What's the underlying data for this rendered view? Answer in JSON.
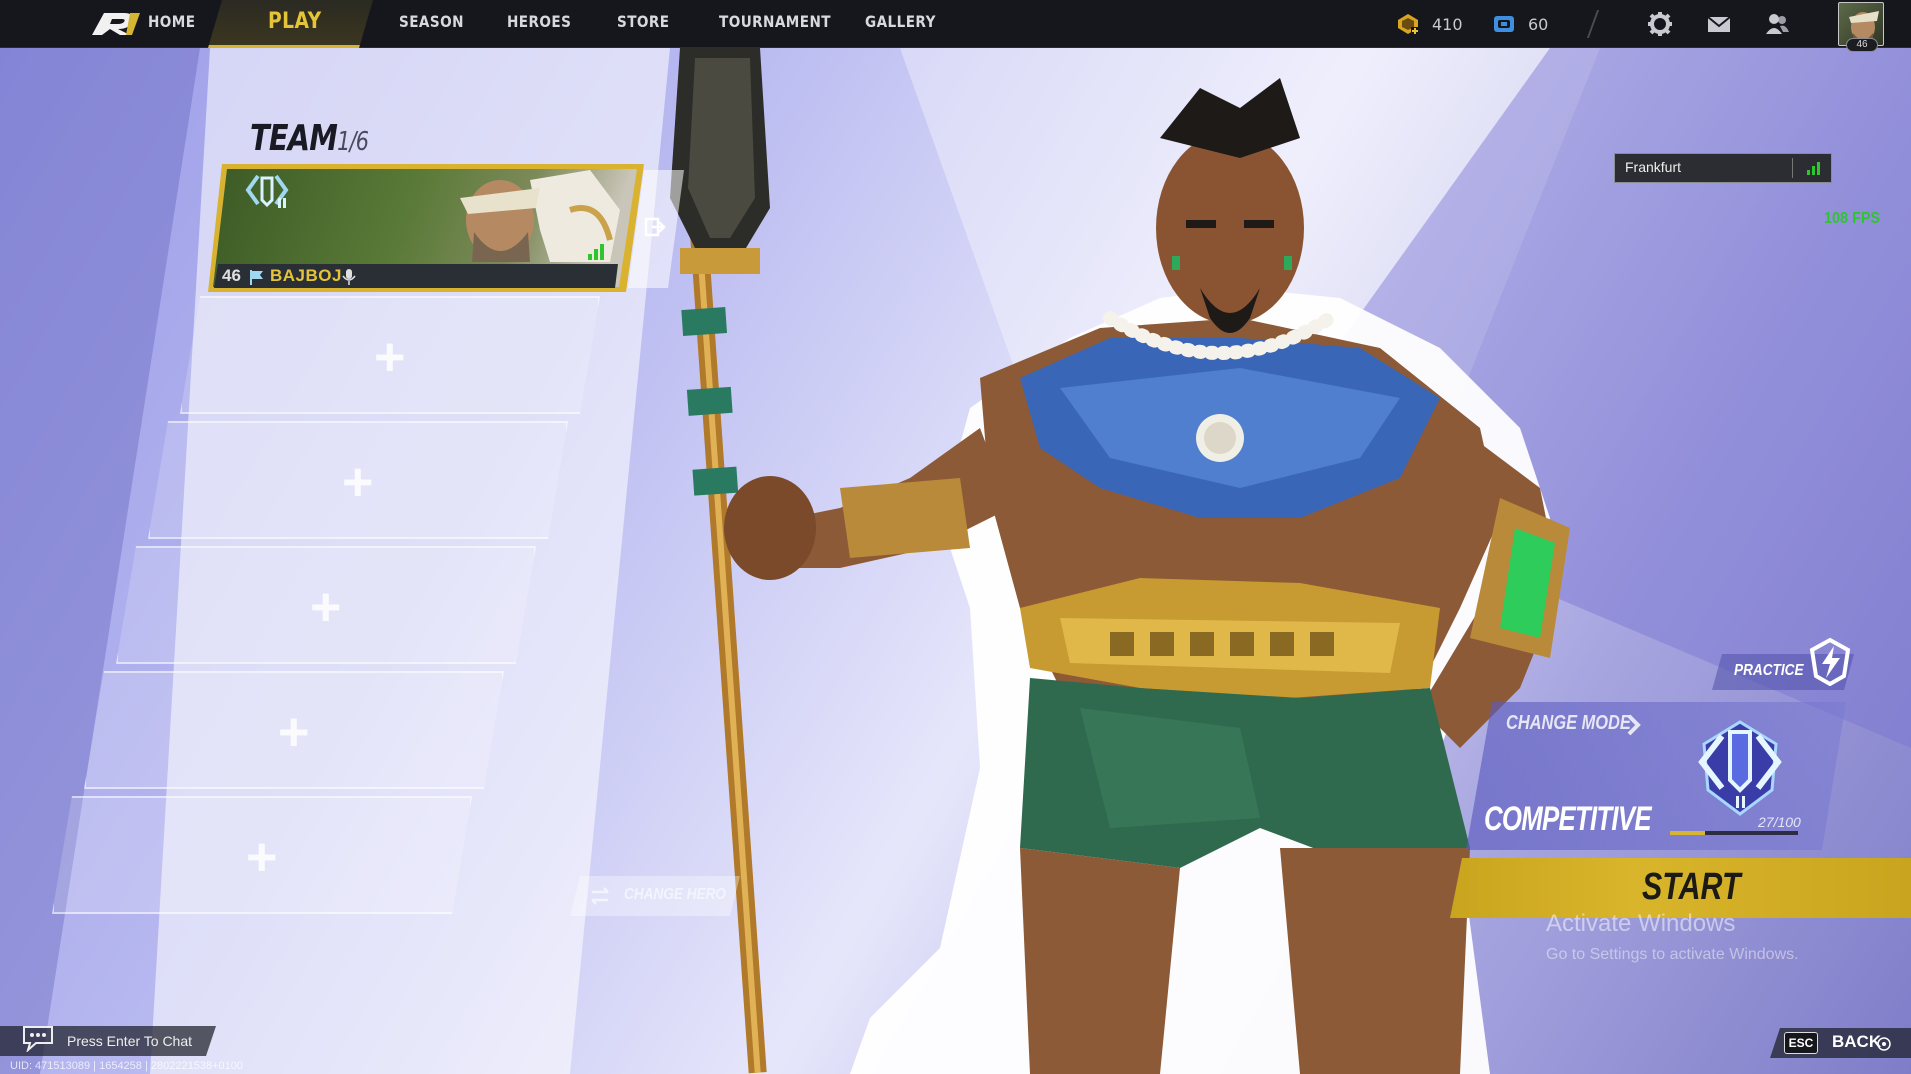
{
  "nav": {
    "home_label": "HOME",
    "items": [
      {
        "label": "PLAY",
        "active": true
      },
      {
        "label": "SEASON",
        "active": false
      },
      {
        "label": "HEROES",
        "active": false
      },
      {
        "label": "STORE",
        "active": false
      },
      {
        "label": "TOURNAMENT",
        "active": false
      },
      {
        "label": "GALLERY",
        "active": false
      }
    ],
    "currencies": [
      {
        "icon": "unit-coin-icon",
        "value": "410"
      },
      {
        "icon": "lattice-coin-icon",
        "value": "60"
      }
    ],
    "icons": [
      "settings-gear-icon",
      "mail-icon",
      "friends-icon"
    ],
    "avatar_level": "46"
  },
  "team": {
    "title": "TEAM",
    "count": "1/6",
    "player": {
      "level": "46",
      "name": "BAJBOJ",
      "rank_icon": "competitive-rank-icon"
    },
    "empty_slots": [
      "+",
      "+",
      "+",
      "+",
      "+"
    ],
    "change_hero_label": "CHANGE HERO"
  },
  "server": {
    "name": "Frankfurt",
    "fps": "108 FPS"
  },
  "mode": {
    "practice_label": "PRACTICE",
    "change_mode_label": "CHANGE MODE",
    "current_mode": "COMPETITIVE",
    "rank_progress": "27/100",
    "rank_progress_fraction": 0.27,
    "start_label": "START"
  },
  "watermark": {
    "title": "Activate Windows",
    "subtitle": "Go to Settings to activate Windows."
  },
  "bottom": {
    "chat_label": "Press Enter To Chat",
    "uid": "UID: 471513089 | 1654258 | 2802221538+0100",
    "esc_key": "ESC",
    "back_label": "BACK"
  },
  "colors": {
    "accent_gold": "#d6b532",
    "topbar": "#15171c",
    "fps_green": "#2ec52e"
  }
}
